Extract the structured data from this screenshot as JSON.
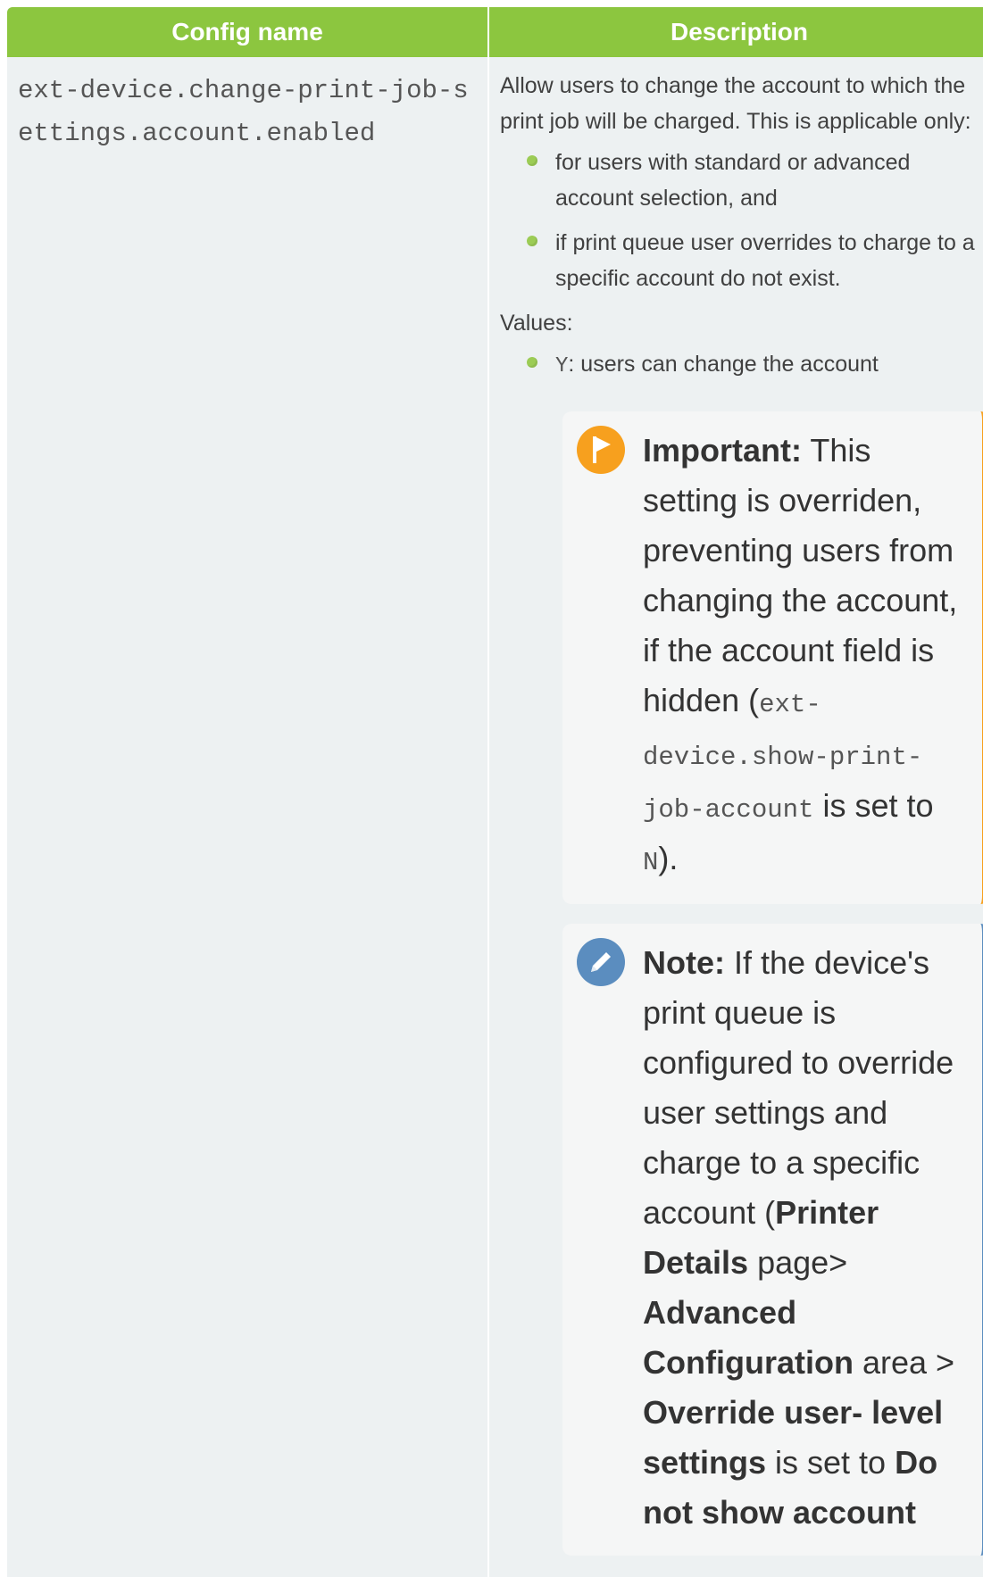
{
  "table": {
    "headers": [
      "Config name",
      "Description"
    ],
    "row": {
      "config_name": "ext-device.change-print-job-settings.account.enabled",
      "description": {
        "intro": "Allow users to change the account to which the print job will be charged. This is applicable only:",
        "conditions": [
          "for users with standard or advanced account selection, and",
          "if print queue user overrides to charge to a specific account do not exist."
        ],
        "values_label": "Values:",
        "values": [
          {
            "code": "Y",
            "text": ": users can change the account"
          }
        ],
        "important": {
          "label": "Important:",
          "text_1": " This setting is overriden, preventing users from changing the account, if the account field is hidden (",
          "code_1": "ext-device.show-print-job-account",
          "text_2": " is set to ",
          "code_2": "N",
          "text_3": ")."
        },
        "note": {
          "label": "Note:",
          "text_1": " If the device's print queue is configured to override user settings and charge to a specific account (",
          "bold_1": "Printer Details",
          "text_2": " page> ",
          "bold_2": "Advanced Configuration",
          "text_3": " area > ",
          "bold_3": "Override user- level settings",
          "text_4": " is set to ",
          "bold_4": "Do not show account"
        }
      }
    }
  },
  "icons": {
    "important": "flag-icon",
    "note": "pencil-icon"
  },
  "colors": {
    "header_bg": "#8cc63f",
    "cell_bg": "#edf1f2",
    "bullet": "#9ccc55",
    "important_accent": "#f7a01e",
    "note_accent": "#5b8dbf"
  }
}
